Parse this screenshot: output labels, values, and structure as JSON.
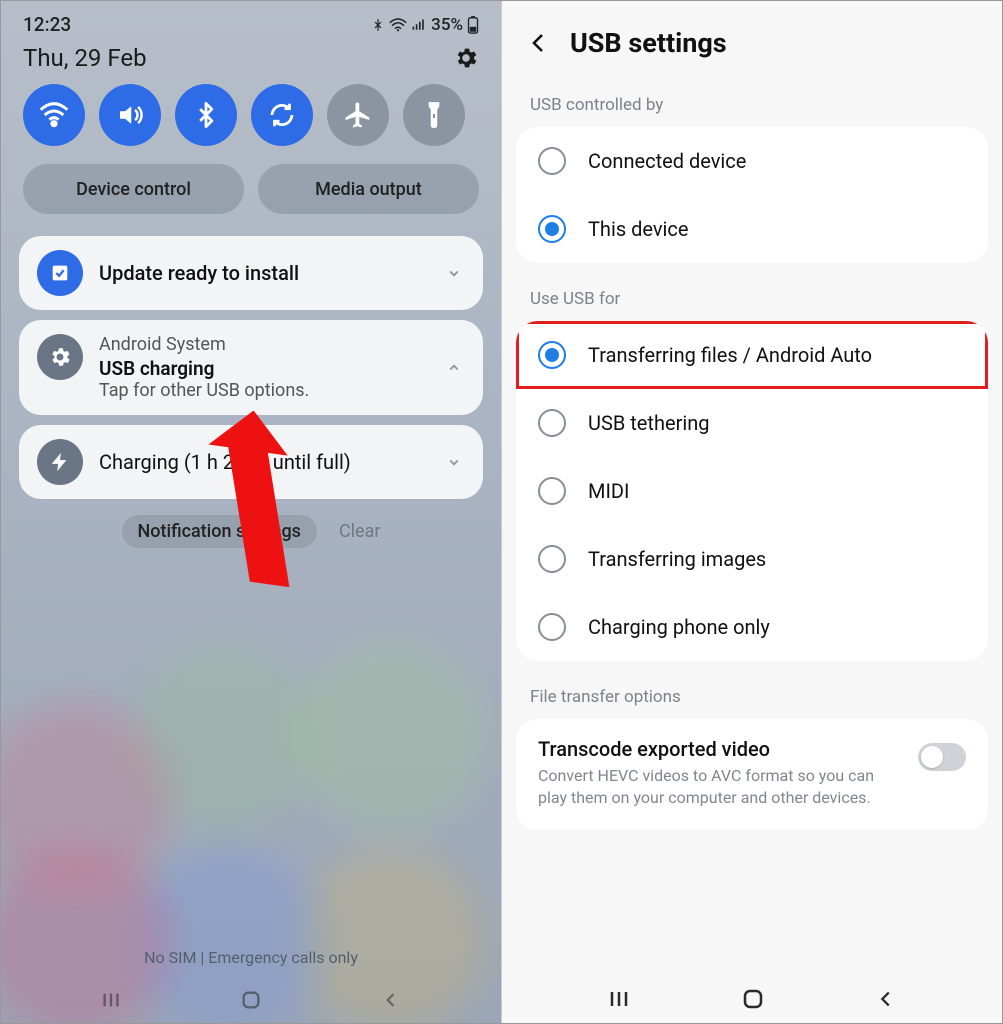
{
  "left": {
    "status": {
      "time": "12:23",
      "battery": "35%"
    },
    "date": "Thu, 29 Feb",
    "pills": {
      "device_control": "Device control",
      "media_output": "Media output"
    },
    "notif_update": "Update ready to install",
    "notif_system": {
      "app": "Android System",
      "title": "USB charging",
      "sub": "Tap for other USB options."
    },
    "notif_charging": "Charging (1 h 27 m until full)",
    "links": {
      "settings": "Notification settings",
      "clear": "Clear"
    },
    "sim": "No SIM | Emergency calls only"
  },
  "right": {
    "title": "USB settings",
    "section_controlled": "USB controlled by",
    "controlled": {
      "connected": "Connected device",
      "this": "This device"
    },
    "section_use": "Use USB for",
    "use": {
      "transfer": "Transferring files / Android Auto",
      "tether": "USB tethering",
      "midi": "MIDI",
      "images": "Transferring images",
      "charge": "Charging phone only"
    },
    "section_ft": "File transfer options",
    "ft": {
      "title": "Transcode exported video",
      "sub": "Convert HEVC videos to AVC format so you can play them on your computer and other devices."
    }
  }
}
